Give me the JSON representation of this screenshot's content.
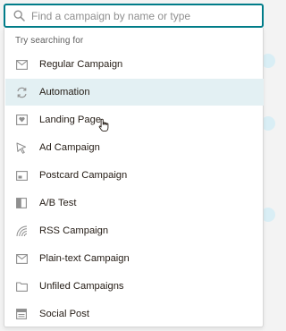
{
  "search": {
    "placeholder": "Find a campaign by name or type",
    "icon": "search-icon"
  },
  "dropdown": {
    "section_label": "Try searching for",
    "items": [
      {
        "label": "Regular Campaign",
        "icon": "envelope-icon"
      },
      {
        "label": "Automation",
        "icon": "refresh-cycle-icon"
      },
      {
        "label": "Landing Page",
        "icon": "landing-page-icon"
      },
      {
        "label": "Ad Campaign",
        "icon": "cursor-arrow-icon"
      },
      {
        "label": "Postcard Campaign",
        "icon": "postcard-icon"
      },
      {
        "label": "A/B Test",
        "icon": "split-test-icon"
      },
      {
        "label": "RSS Campaign",
        "icon": "rss-icon"
      },
      {
        "label": "Plain-text Campaign",
        "icon": "envelope-icon"
      },
      {
        "label": "Unfiled Campaigns",
        "icon": "folder-icon"
      },
      {
        "label": "Social Post",
        "icon": "social-post-icon"
      }
    ],
    "hovered_item": "Automation"
  },
  "colors": {
    "accent": "#007c89",
    "hover_bg": "#e3f0f3",
    "icon": "#8f8f8f",
    "text": "#241c15"
  }
}
